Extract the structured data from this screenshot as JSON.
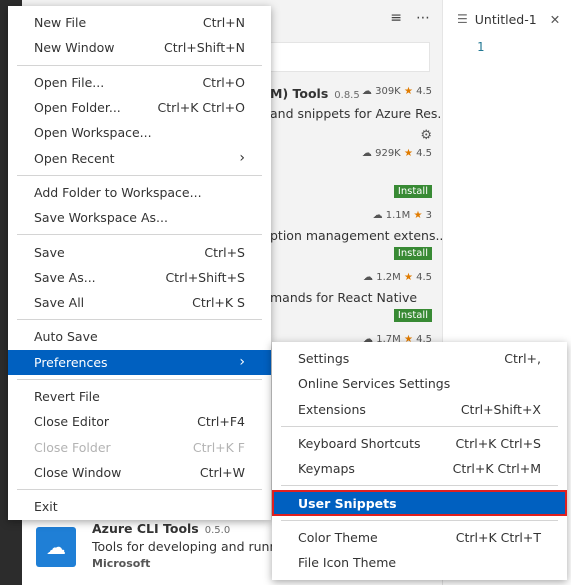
{
  "side_panel": {
    "extensions": [
      {
        "title": "M) Tools",
        "version": "0.8.5",
        "desc": "and snippets for Azure Res...",
        "installs": "309K",
        "rating": "4.5"
      },
      {
        "installs": "929K",
        "rating": "4.5",
        "install_label": "Install"
      },
      {
        "installs": "1.1M",
        "rating": "3",
        "desc": "ption management extens...",
        "install_label": "Install"
      },
      {
        "installs": "1.2M",
        "rating": "4.5",
        "desc": "mands for React Native",
        "install_label": "Install"
      },
      {
        "installs": "1.7M",
        "rating": "4.5"
      }
    ],
    "azure_cli": {
      "title": "Azure CLI Tools",
      "version": "0.5.0",
      "desc": "Tools for developing and running",
      "publisher": "Microsoft"
    }
  },
  "editor": {
    "tab_title": "Untitled-1",
    "line_number": "1"
  },
  "file_menu": {
    "new_file": {
      "label": "New File",
      "shortcut": "Ctrl+N"
    },
    "new_window": {
      "label": "New Window",
      "shortcut": "Ctrl+Shift+N"
    },
    "open_file": {
      "label": "Open File...",
      "shortcut": "Ctrl+O"
    },
    "open_folder": {
      "label": "Open Folder...",
      "shortcut": "Ctrl+K Ctrl+O"
    },
    "open_workspace": {
      "label": "Open Workspace..."
    },
    "open_recent": {
      "label": "Open Recent"
    },
    "add_folder": {
      "label": "Add Folder to Workspace..."
    },
    "save_workspace_as": {
      "label": "Save Workspace As..."
    },
    "save": {
      "label": "Save",
      "shortcut": "Ctrl+S"
    },
    "save_as": {
      "label": "Save As...",
      "shortcut": "Ctrl+Shift+S"
    },
    "save_all": {
      "label": "Save All",
      "shortcut": "Ctrl+K S"
    },
    "auto_save": {
      "label": "Auto Save"
    },
    "preferences": {
      "label": "Preferences"
    },
    "revert_file": {
      "label": "Revert File"
    },
    "close_editor": {
      "label": "Close Editor",
      "shortcut": "Ctrl+F4"
    },
    "close_folder": {
      "label": "Close Folder",
      "shortcut": "Ctrl+K F"
    },
    "close_window": {
      "label": "Close Window",
      "shortcut": "Ctrl+W"
    },
    "exit": {
      "label": "Exit"
    }
  },
  "preferences_menu": {
    "settings": {
      "label": "Settings",
      "shortcut": "Ctrl+,"
    },
    "online_services": {
      "label": "Online Services Settings"
    },
    "extensions": {
      "label": "Extensions",
      "shortcut": "Ctrl+Shift+X"
    },
    "keyboard_shortcuts": {
      "label": "Keyboard Shortcuts",
      "shortcut": "Ctrl+K Ctrl+S"
    },
    "keymaps": {
      "label": "Keymaps",
      "shortcut": "Ctrl+K Ctrl+M"
    },
    "user_snippets": {
      "label": "User Snippets"
    },
    "color_theme": {
      "label": "Color Theme",
      "shortcut": "Ctrl+K Ctrl+T"
    },
    "file_icon_theme": {
      "label": "File Icon Theme"
    }
  },
  "colors": {
    "highlight": "#0060c0",
    "callout_border": "#e02020",
    "install_button": "#388a34",
    "star": "#e07b00"
  }
}
